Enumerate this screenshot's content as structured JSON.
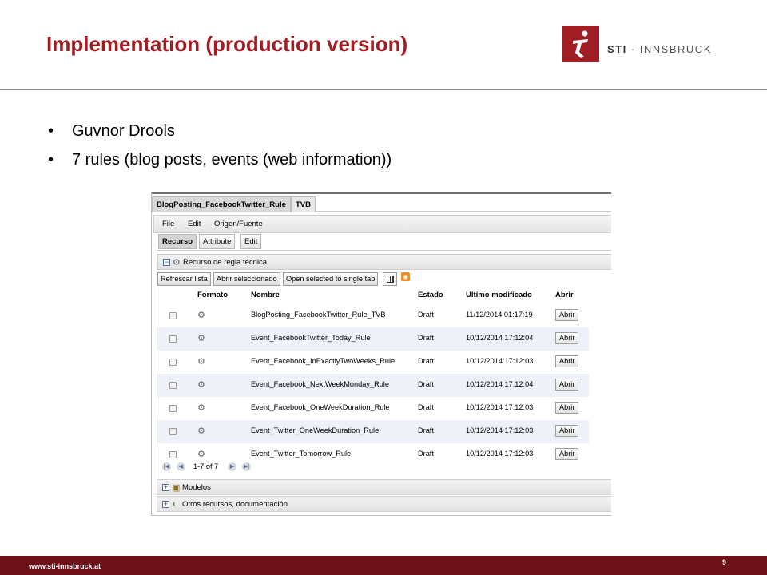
{
  "slide": {
    "title": "Implementation (production version)",
    "logo": {
      "brand": "STI",
      "separator": " · ",
      "name": "INNSBRUCK"
    },
    "bullets": [
      "Guvnor Drools",
      "7 rules (blog posts, events (web information))"
    ],
    "footer": {
      "url": "www.sti-innsbruck.at",
      "page_number": "9"
    },
    "colors": {
      "accent": "#a01e23",
      "footer": "#6f1118"
    }
  },
  "app": {
    "doc_tabs": [
      "BlogPosting_FacebookTwitter_Rule",
      "TVB"
    ],
    "menu": [
      "File",
      "Edit",
      "Origen/Fuente"
    ],
    "editor_tabs": [
      "Recurso",
      "Attribute",
      "Edit"
    ],
    "sections": {
      "main": "Recurso de regla técnica",
      "models": "Modelos",
      "others": "Otros recursos, documentación"
    },
    "toolbar": {
      "refresh": "Refrescar lista",
      "open_selected": "Abrir seleccionado",
      "open_single_tab": "Open selected to single tab"
    },
    "columns": {
      "format": "Formato",
      "name": "Nombre",
      "status": "Estado",
      "modified": "Ultimo modificado",
      "open": "Abrir"
    },
    "rows": [
      {
        "name": "BlogPosting_FacebookTwitter_Rule_TVB",
        "status": "Draft",
        "modified": "11/12/2014 01:17:19",
        "open": "Abrir"
      },
      {
        "name": "Event_FacebookTwitter_Today_Rule",
        "status": "Draft",
        "modified": "10/12/2014 17:12:04",
        "open": "Abrir"
      },
      {
        "name": "Event_Facebook_InExactlyTwoWeeks_Rule",
        "status": "Draft",
        "modified": "10/12/2014 17:12:03",
        "open": "Abrir"
      },
      {
        "name": "Event_Facebook_NextWeekMonday_Rule",
        "status": "Draft",
        "modified": "10/12/2014 17:12:04",
        "open": "Abrir"
      },
      {
        "name": "Event_Facebook_OneWeekDuration_Rule",
        "status": "Draft",
        "modified": "10/12/2014 17:12:03",
        "open": "Abrir"
      },
      {
        "name": "Event_Twitter_OneWeekDuration_Rule",
        "status": "Draft",
        "modified": "10/12/2014 17:12:03",
        "open": "Abrir"
      },
      {
        "name": "Event_Twitter_Tomorrow_Rule",
        "status": "Draft",
        "modified": "10/12/2014 17:12:03",
        "open": "Abrir"
      }
    ],
    "pager": {
      "text": "1-7 of 7"
    },
    "icons": {
      "toggle_open": "minus-icon",
      "toggle_closed": "plus-icon",
      "format": "rule-gear-icon",
      "columns": "column-chooser-icon",
      "feed": "rss-icon"
    }
  }
}
